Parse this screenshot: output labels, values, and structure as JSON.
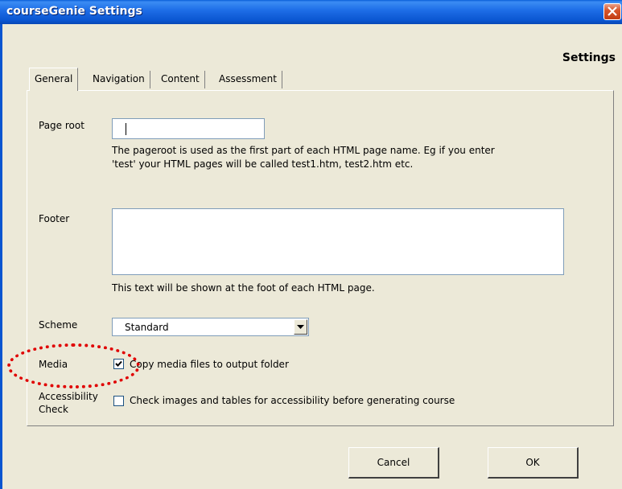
{
  "window": {
    "title": "courseGenie Settings",
    "heading": "Settings"
  },
  "tabs": [
    {
      "label": "General",
      "active": true
    },
    {
      "label": "Navigation",
      "active": false
    },
    {
      "label": "Content",
      "active": false
    },
    {
      "label": "Assessment",
      "active": false
    }
  ],
  "general": {
    "page_root": {
      "label": "Page root",
      "value": "",
      "help_line1": "The pageroot is used as the first part of each HTML page name. Eg if you enter",
      "help_line2": "'test' your HTML pages will be called test1.htm, test2.htm etc."
    },
    "footer": {
      "label": "Footer",
      "value": "",
      "help": "This text will be shown at the foot of each HTML page."
    },
    "scheme": {
      "label": "Scheme",
      "selected": "Standard"
    },
    "media": {
      "label": "Media",
      "checkbox_label": "Copy media files to output folder",
      "checked": true
    },
    "accessibility": {
      "label_line1": "Accessibility",
      "label_line2": "Check",
      "checkbox_label": "Check images and tables for accessibility before generating course",
      "checked": false
    }
  },
  "buttons": {
    "cancel": "Cancel",
    "ok": "OK"
  },
  "colors": {
    "titlebar": "#0a55d0",
    "dialog_bg": "#ece9d8",
    "annotation": "#e00000"
  }
}
